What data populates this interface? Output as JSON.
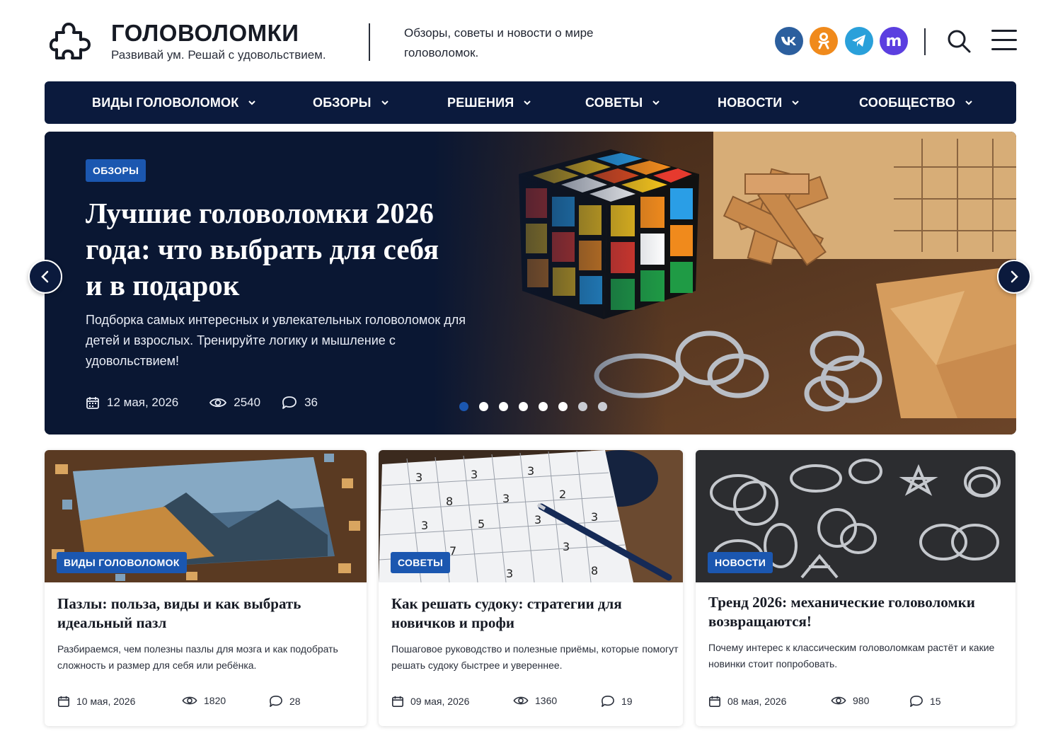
{
  "site": {
    "title": "ГОЛОВОЛОМКИ",
    "tagline": "Развивай ум. Решай с удовольствием.",
    "description": "Обзоры, советы и новости о мире головоломок."
  },
  "social": [
    {
      "name": "vk",
      "label": "vk",
      "color": "#2c5f9e"
    },
    {
      "name": "ok",
      "label": "ok",
      "color": "#f08a1c"
    },
    {
      "name": "telegram",
      "label": "telegram",
      "color": "#2aa0da"
    },
    {
      "name": "max",
      "label": "m",
      "color": "#5b3fe0"
    }
  ],
  "nav": {
    "items": [
      {
        "label": "ВИДЫ ГОЛОВОЛОМОК"
      },
      {
        "label": "ОБЗОРЫ"
      },
      {
        "label": "РЕШЕНИЯ"
      },
      {
        "label": "СОВЕТЫ"
      },
      {
        "label": "НОВОСТИ"
      },
      {
        "label": "СООБЩЕСТВО"
      }
    ]
  },
  "hero": {
    "badge": "ОБЗОРЫ",
    "title": "Лучшие головоломки 2026 года: что выбрать для себя и в подарок",
    "text": "Подборка самых интересных и увлекательных головоломок для детей и взрослых. Тренируйте логику и мышление с удовольствием!",
    "date": "12 мая, 2026",
    "views": "2540",
    "comments": "36",
    "slides_total": 8,
    "active_slide": 1
  },
  "cards": [
    {
      "badge": "ВИДЫ ГОЛОВОЛОМОК",
      "title": "Пазлы: польза, виды и как выбрать идеальный пазл",
      "text": "Разбираемся, чем полезны пазлы для мозга и как подобрать сложность и размер для себя или ребёнка.",
      "date": "10 мая, 2026",
      "views": "1820",
      "comments": "28"
    },
    {
      "badge": "СОВЕТЫ",
      "title": "Как решать судоку: стратегии для новичков и профи",
      "text": "Пошаговое руководство и полезные приёмы, которые помогут решать судоку быстрее и увереннее.",
      "date": "09 мая, 2026",
      "views": "1360",
      "comments": "19"
    },
    {
      "badge": "НОВОСТИ",
      "title": "Тренд 2026: механические головоломки возвращаются!",
      "text": "Почему интерес к классическим головоломкам растёт и какие новинки стоит попробовать.",
      "date": "08 мая, 2026",
      "views": "980",
      "comments": "15"
    }
  ],
  "colors": {
    "navy": "#0b1a3d",
    "accent": "#1b57b0"
  }
}
